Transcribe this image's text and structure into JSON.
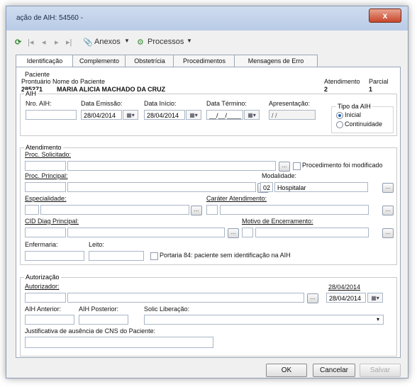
{
  "window": {
    "title": "ação de AIH: 54560 -",
    "close_label": "x"
  },
  "toolbar": {
    "anexos": "Anexos",
    "processos": "Processos"
  },
  "tabs": [
    "Identificação",
    "Complemento",
    "Obstetrícia",
    "Procedimentos",
    "Mensagens de Erro"
  ],
  "paciente": {
    "group": "Paciente",
    "prontuario_label": "Prontuário",
    "nome_label": "Nome do Paciente",
    "atendimento_label": "Atendimento",
    "parcial_label": "Parcial",
    "prontuario": "285271",
    "nome": "MARIA ALICIA MACHADO DA CRUZ",
    "atendimento": "2",
    "parcial": "1"
  },
  "aih": {
    "group": "AIH",
    "nro_label": "Nro. AIH:",
    "emissao_label": "Data Emissão:",
    "emissao": "28/04/2014",
    "inicio_label": "Data Início:",
    "inicio": "28/04/2014",
    "termino_label": "Data Término:",
    "termino": "__/__/____",
    "apresentacao_label": "Apresentação:",
    "apresentacao": " / /",
    "tipo_label": "Tipo da AIH",
    "tipo_inicial": "Inicial",
    "tipo_continuidade": "Continuidade"
  },
  "atendimento": {
    "group": "Atendimento",
    "proc_solicitado": "Proc. Solicitado:",
    "proc_modificado": "Procedimento foi modificado",
    "proc_principal": "Proc. Principal:",
    "modalidade_label": "Modalidade:",
    "modalidade_code": "02",
    "modalidade": "Hospitalar",
    "especialidade": "Especialidade:",
    "carater": "Caráter Atendimento:",
    "cid": "CID Diag Principal:",
    "motivo": "Motivo de Encerramento:",
    "enfermaria": "Enfermaria:",
    "leito": "Leito:",
    "portaria": "Portaria 84: paciente sem identificação na AIH"
  },
  "autorizacao": {
    "group": "Autorização",
    "autorizador": "Autorizador:",
    "data_label": "Data Autorização:",
    "data": "28/04/2014",
    "aih_anterior": "AIH Anterior:",
    "aih_posterior": "AIH Posterior:",
    "solic_liberacao": "Solic Liberação:",
    "justificativa": "Justificativa de ausência de CNS do Paciente:"
  },
  "buttons": {
    "ok": "OK",
    "cancelar": "Cancelar",
    "salvar": "Salvar"
  },
  "icons": {
    "ellipsis": "...",
    "calendar": "▦▾",
    "dropdown": "▾"
  }
}
